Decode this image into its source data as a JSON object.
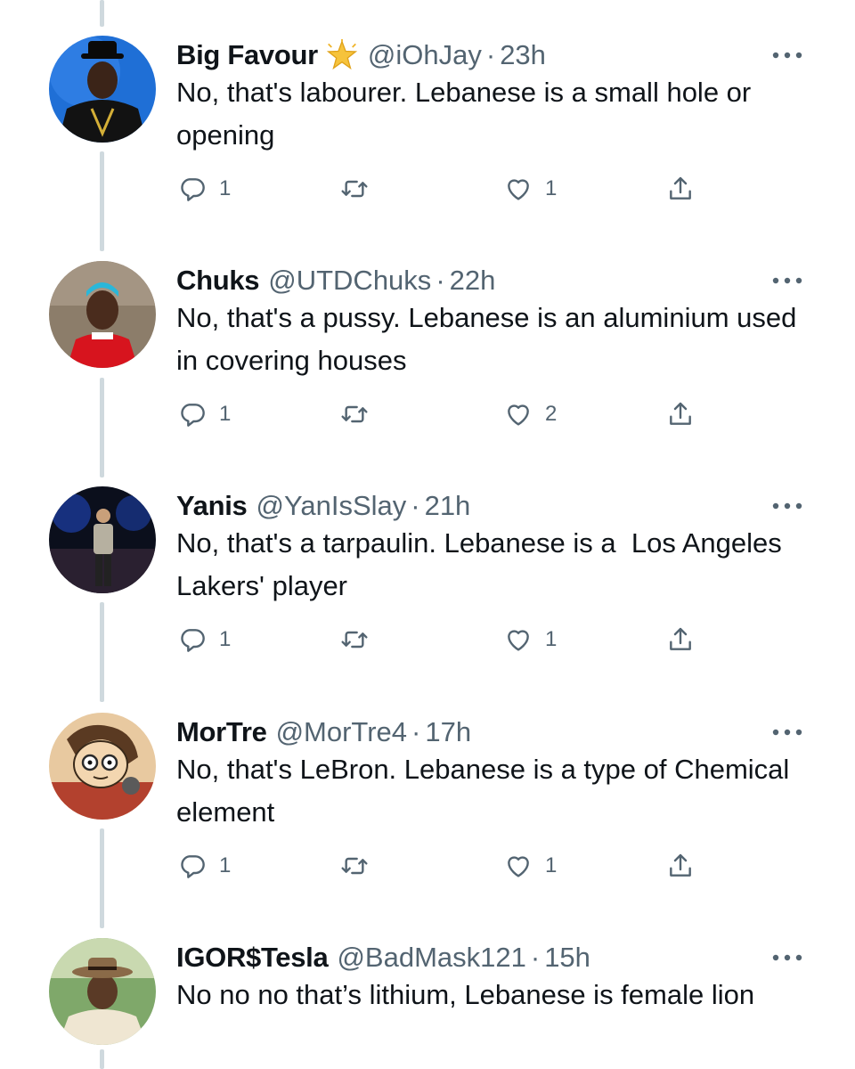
{
  "replies": [
    {
      "name": "Big Favour",
      "verified_badge_icon": "star-badge-icon",
      "handle": "@iOhJay",
      "dot": "·",
      "time": "23h",
      "text": "No, that's labourer. Lebanese is a small hole or opening",
      "reply_count": "1",
      "retweet_count": "",
      "like_count": "1"
    },
    {
      "name": "Chuks",
      "handle": "@UTDChuks",
      "dot": "·",
      "time": "22h",
      "text": "No, that's a pussy. Lebanese is an aluminium used in covering houses",
      "reply_count": "1",
      "retweet_count": "",
      "like_count": "2"
    },
    {
      "name": "Yanis",
      "handle": "@YanIsSlay",
      "dot": "·",
      "time": "21h",
      "text": "No, that's a tarpaulin. Lebanese is a  Los Angeles Lakers' player",
      "reply_count": "1",
      "retweet_count": "",
      "like_count": "1"
    },
    {
      "name": "MorTre",
      "handle": "@MorTre4",
      "dot": "·",
      "time": "17h",
      "text": "No, that's LeBron. Lebanese is a type of Chemical element",
      "reply_count": "1",
      "retweet_count": "",
      "like_count": "1"
    },
    {
      "name": "IGOR$Tesla",
      "handle": "@BadMask121",
      "dot": "·",
      "time": "15h",
      "text": "No no no that’s lithium, Lebanese is female lion",
      "reply_count": "",
      "retweet_count": "",
      "like_count": ""
    }
  ],
  "icons": {
    "reply": "reply-icon",
    "retweet": "retweet-icon",
    "like": "heart-icon",
    "share": "share-icon",
    "more": "more-options-icon"
  },
  "colors": {
    "text": "#0f1419",
    "secondary": "#536471",
    "thread_line": "#cfd9de",
    "background": "#ffffff"
  }
}
